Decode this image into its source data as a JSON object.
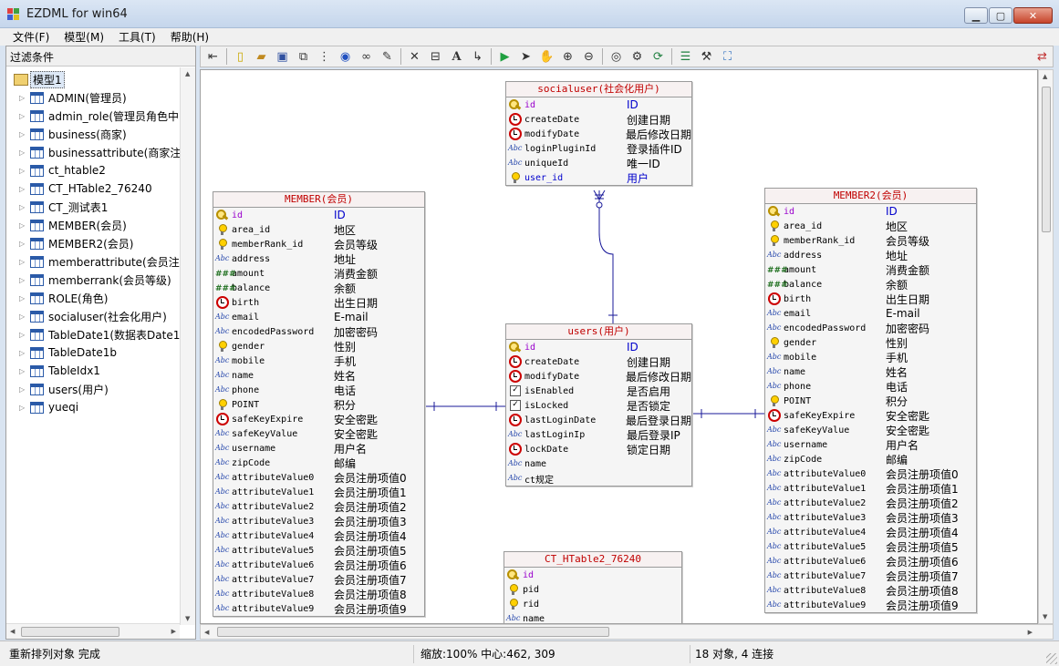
{
  "window": {
    "title": "EZDML for win64"
  },
  "menu": [
    "文件(F)",
    "模型(M)",
    "工具(T)",
    "帮助(H)"
  ],
  "left_panel": {
    "filter_label": "过滤条件",
    "root": "模型1",
    "items": [
      "ADMIN(管理员)",
      "admin_role(管理员角色中",
      "business(商家)",
      "businessattribute(商家注",
      "ct_htable2",
      "CT_HTable2_76240",
      "CT_测试表1",
      "MEMBER(会员)",
      "MEMBER2(会员)",
      "memberattribute(会员注",
      "memberrank(会员等级)",
      "ROLE(角色)",
      "socialuser(社会化用户)",
      "TableDate1(数据表Date1",
      "TableDate1b",
      "TableIdx1",
      "users(用户)",
      "yueqi"
    ]
  },
  "entities": {
    "member": {
      "title": "MEMBER(会员)",
      "fields": [
        {
          "icon": "key",
          "name": "id",
          "label": "ID",
          "kind": "pk"
        },
        {
          "icon": "bulb",
          "name": "area_id",
          "label": "地区"
        },
        {
          "icon": "bulb",
          "name": "memberRank_id",
          "label": "会员等级"
        },
        {
          "icon": "abc",
          "name": "address",
          "label": "地址"
        },
        {
          "icon": "num",
          "name": "amount",
          "label": "消费金额"
        },
        {
          "icon": "num",
          "name": "balance",
          "label": "余额"
        },
        {
          "icon": "clock",
          "name": "birth",
          "label": "出生日期"
        },
        {
          "icon": "abc",
          "name": "email",
          "label": "E-mail"
        },
        {
          "icon": "abc",
          "name": "encodedPassword",
          "label": "加密密码"
        },
        {
          "icon": "bulb",
          "name": "gender",
          "label": "性别"
        },
        {
          "icon": "abc",
          "name": "mobile",
          "label": "手机"
        },
        {
          "icon": "abc",
          "name": "name",
          "label": "姓名"
        },
        {
          "icon": "abc",
          "name": "phone",
          "label": "电话"
        },
        {
          "icon": "bulb",
          "name": "POINT",
          "label": "积分"
        },
        {
          "icon": "clock",
          "name": "safeKeyExpire",
          "label": "安全密匙"
        },
        {
          "icon": "abc",
          "name": "safeKeyValue",
          "label": "安全密匙"
        },
        {
          "icon": "abc",
          "name": "username",
          "label": "用户名"
        },
        {
          "icon": "abc",
          "name": "zipCode",
          "label": "邮编"
        },
        {
          "icon": "abc",
          "name": "attributeValue0",
          "label": "会员注册项值0"
        },
        {
          "icon": "abc",
          "name": "attributeValue1",
          "label": "会员注册项值1"
        },
        {
          "icon": "abc",
          "name": "attributeValue2",
          "label": "会员注册项值2"
        },
        {
          "icon": "abc",
          "name": "attributeValue3",
          "label": "会员注册项值3"
        },
        {
          "icon": "abc",
          "name": "attributeValue4",
          "label": "会员注册项值4"
        },
        {
          "icon": "abc",
          "name": "attributeValue5",
          "label": "会员注册项值5"
        },
        {
          "icon": "abc",
          "name": "attributeValue6",
          "label": "会员注册项值6"
        },
        {
          "icon": "abc",
          "name": "attributeValue7",
          "label": "会员注册项值7"
        },
        {
          "icon": "abc",
          "name": "attributeValue8",
          "label": "会员注册项值8"
        },
        {
          "icon": "abc",
          "name": "attributeValue9",
          "label": "会员注册项值9"
        }
      ]
    },
    "socialuser": {
      "title": "socialuser(社会化用户)",
      "fields": [
        {
          "icon": "key",
          "name": "id",
          "label": "ID",
          "kind": "pk"
        },
        {
          "icon": "clock",
          "name": "createDate",
          "label": "创建日期"
        },
        {
          "icon": "clock",
          "name": "modifyDate",
          "label": "最后修改日期"
        },
        {
          "icon": "abc",
          "name": "loginPluginId",
          "label": "登录插件ID"
        },
        {
          "icon": "abc",
          "name": "uniqueId",
          "label": "唯一ID"
        },
        {
          "icon": "bulb",
          "name": "user_id",
          "label": "用户",
          "kind": "fk"
        }
      ]
    },
    "users": {
      "title": "users(用户)",
      "fields": [
        {
          "icon": "key",
          "name": "id",
          "label": "ID",
          "kind": "pk"
        },
        {
          "icon": "clock",
          "name": "createDate",
          "label": "创建日期"
        },
        {
          "icon": "clock",
          "name": "modifyDate",
          "label": "最后修改日期"
        },
        {
          "icon": "check",
          "name": "isEnabled",
          "label": "是否启用"
        },
        {
          "icon": "check",
          "name": "isLocked",
          "label": "是否锁定"
        },
        {
          "icon": "clock",
          "name": "lastLoginDate",
          "label": "最后登录日期"
        },
        {
          "icon": "abc",
          "name": "lastLoginIp",
          "label": "最后登录IP"
        },
        {
          "icon": "clock",
          "name": "lockDate",
          "label": "锁定日期"
        },
        {
          "icon": "abc",
          "name": "name",
          "label": ""
        },
        {
          "icon": "abc",
          "name": "ct规定",
          "label": ""
        }
      ]
    },
    "member2": {
      "title": "MEMBER2(会员)",
      "fields": [
        {
          "icon": "key",
          "name": "id",
          "label": "ID",
          "kind": "pk"
        },
        {
          "icon": "bulb",
          "name": "area_id",
          "label": "地区"
        },
        {
          "icon": "bulb",
          "name": "memberRank_id",
          "label": "会员等级"
        },
        {
          "icon": "abc",
          "name": "address",
          "label": "地址"
        },
        {
          "icon": "num",
          "name": "amount",
          "label": "消费金额"
        },
        {
          "icon": "num",
          "name": "balance",
          "label": "余额"
        },
        {
          "icon": "clock",
          "name": "birth",
          "label": "出生日期"
        },
        {
          "icon": "abc",
          "name": "email",
          "label": "E-mail"
        },
        {
          "icon": "abc",
          "name": "encodedPassword",
          "label": "加密密码"
        },
        {
          "icon": "bulb",
          "name": "gender",
          "label": "性别"
        },
        {
          "icon": "abc",
          "name": "mobile",
          "label": "手机"
        },
        {
          "icon": "abc",
          "name": "name",
          "label": "姓名"
        },
        {
          "icon": "abc",
          "name": "phone",
          "label": "电话"
        },
        {
          "icon": "bulb",
          "name": "POINT",
          "label": "积分"
        },
        {
          "icon": "clock",
          "name": "safeKeyExpire",
          "label": "安全密匙"
        },
        {
          "icon": "abc",
          "name": "safeKeyValue",
          "label": "安全密匙"
        },
        {
          "icon": "abc",
          "name": "username",
          "label": "用户名"
        },
        {
          "icon": "abc",
          "name": "zipCode",
          "label": "邮编"
        },
        {
          "icon": "abc",
          "name": "attributeValue0",
          "label": "会员注册项值0"
        },
        {
          "icon": "abc",
          "name": "attributeValue1",
          "label": "会员注册项值1"
        },
        {
          "icon": "abc",
          "name": "attributeValue2",
          "label": "会员注册项值2"
        },
        {
          "icon": "abc",
          "name": "attributeValue3",
          "label": "会员注册项值3"
        },
        {
          "icon": "abc",
          "name": "attributeValue4",
          "label": "会员注册项值4"
        },
        {
          "icon": "abc",
          "name": "attributeValue5",
          "label": "会员注册项值5"
        },
        {
          "icon": "abc",
          "name": "attributeValue6",
          "label": "会员注册项值6"
        },
        {
          "icon": "abc",
          "name": "attributeValue7",
          "label": "会员注册项值7"
        },
        {
          "icon": "abc",
          "name": "attributeValue8",
          "label": "会员注册项值8"
        },
        {
          "icon": "abc",
          "name": "attributeValue9",
          "label": "会员注册项值9"
        }
      ]
    },
    "ct_htable2": {
      "title": "CT_HTable2_76240",
      "fields": [
        {
          "icon": "key",
          "name": "id",
          "label": "",
          "kind": "pk"
        },
        {
          "icon": "bulb",
          "name": "pid",
          "label": ""
        },
        {
          "icon": "bulb",
          "name": "rid",
          "label": ""
        },
        {
          "icon": "abc",
          "name": "name",
          "label": ""
        }
      ]
    }
  },
  "status": {
    "message": "重新排列对象 完成",
    "zoom": "缩放:100% 中心:462, 309",
    "count": "18 对象, 4 连接"
  },
  "colors": {
    "title_red": "#c00000",
    "link_blue": "#00008b",
    "pk_purple": "#9900cc"
  }
}
